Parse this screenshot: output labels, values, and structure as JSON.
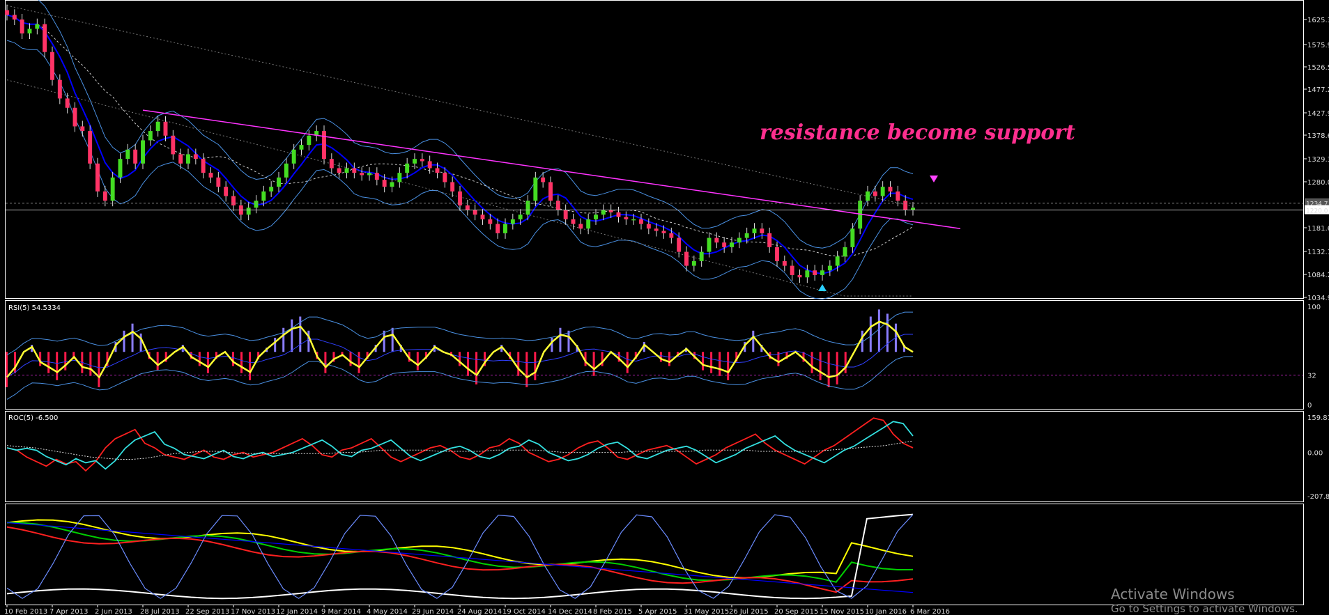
{
  "chart_data": [
    {
      "type": "candlestick",
      "panel": "price",
      "title": "",
      "y_ticks": [
        "1625.3",
        "1575.9",
        "1526.5",
        "1477.2",
        "1427.9",
        "1378.6",
        "1329.3",
        "1280.0",
        "1181.6",
        "1132.1",
        "1084.2",
        "1034.9"
      ],
      "ylim": [
        1034.9,
        1660
      ],
      "current_price_label": "1220.0",
      "upper_price_label": "1234.7",
      "x_labels": [
        "10 Feb 2013",
        "7 Apr 2013",
        "2 Jun 2013",
        "28 Jul 2013",
        "22 Sep 2013",
        "17 Nov 2013",
        "12 Jan 2014",
        "9 Mar 2014",
        "4 May 2014",
        "29 Jun 2014",
        "24 Aug 2014",
        "19 Oct 2014",
        "14 Dec 2014",
        "8 Feb 2015",
        "5 Apr 2015",
        "31 May 2015",
        "26 Jul 2015",
        "20 Sep 2015",
        "15 Nov 2015",
        "10 Jan 2016",
        "6 Mar 2016"
      ],
      "closes": [
        1640,
        1630,
        1600,
        1610,
        1620,
        1560,
        1500,
        1460,
        1440,
        1400,
        1390,
        1320,
        1260,
        1240,
        1290,
        1330,
        1350,
        1320,
        1370,
        1390,
        1410,
        1380,
        1340,
        1320,
        1340,
        1330,
        1300,
        1290,
        1270,
        1250,
        1230,
        1210,
        1225,
        1240,
        1260,
        1270,
        1290,
        1320,
        1350,
        1360,
        1380,
        1390,
        1330,
        1310,
        1300,
        1310,
        1300,
        1295,
        1300,
        1285,
        1270,
        1280,
        1300,
        1320,
        1330,
        1325,
        1310,
        1300,
        1280,
        1260,
        1230,
        1220,
        1210,
        1200,
        1190,
        1170,
        1190,
        1200,
        1210,
        1240,
        1290,
        1280,
        1240,
        1220,
        1200,
        1190,
        1180,
        1200,
        1210,
        1220,
        1215,
        1205,
        1200,
        1200,
        1190,
        1180,
        1175,
        1170,
        1160,
        1130,
        1100,
        1110,
        1130,
        1160,
        1150,
        1140,
        1150,
        1160,
        1170,
        1180,
        1170,
        1140,
        1110,
        1100,
        1080,
        1075,
        1090,
        1080,
        1090,
        1100,
        1120,
        1140,
        1180,
        1240,
        1260,
        1250,
        1270,
        1260,
        1240,
        1220,
        1225
      ],
      "annotations": [
        {
          "text": "resistance become support",
          "color": "#ff2f8f"
        }
      ],
      "trendline": {
        "from": [
          "28 Jul 2013",
          1435
        ],
        "to": [
          "6 Mar 2016",
          1195
        ],
        "color": "#ff33ff"
      },
      "arrows": [
        {
          "at": "15 Nov 2015",
          "dir": "up",
          "color": "#2ad0ff"
        },
        {
          "at": "6 Mar 2016",
          "dir": "down",
          "color": "#ff44ff"
        }
      ]
    },
    {
      "type": "bar+line",
      "panel": "rsi",
      "title": "RSI(5) 54.5334",
      "y_ticks": [
        "100",
        "32",
        "0"
      ],
      "ylim": [
        0,
        100
      ],
      "level": 32,
      "rsi_values": [
        30,
        40,
        55,
        60,
        45,
        40,
        35,
        42,
        50,
        40,
        38,
        30,
        45,
        62,
        70,
        75,
        68,
        50,
        42,
        48,
        55,
        60,
        50,
        45,
        40,
        50,
        55,
        45,
        40,
        35,
        50,
        58,
        65,
        72,
        78,
        80,
        70,
        50,
        40,
        48,
        52,
        45,
        40,
        50,
        60,
        70,
        72,
        60,
        48,
        42,
        50,
        60,
        55,
        52,
        45,
        38,
        32,
        45,
        55,
        60,
        50,
        38,
        30,
        35,
        55,
        65,
        72,
        70,
        60,
        45,
        38,
        45,
        55,
        48,
        40,
        50,
        62,
        55,
        48,
        45,
        52,
        58,
        50,
        42,
        40,
        38,
        35,
        48,
        62,
        70,
        60,
        50,
        45,
        50,
        55,
        48,
        40,
        35,
        30,
        32,
        40,
        55,
        70,
        80,
        85,
        82,
        75,
        60,
        55
      ]
    },
    {
      "type": "line",
      "panel": "roc",
      "title": "ROC(5) -6.500",
      "y_ticks": [
        "159.81",
        "0.00",
        "-207.81"
      ],
      "ylim": [
        -207.81,
        159.81
      ],
      "roc_values": [
        20,
        10,
        -20,
        -40,
        -60,
        -30,
        -50,
        -40,
        -80,
        -40,
        20,
        60,
        80,
        100,
        40,
        20,
        -10,
        -20,
        -30,
        -10,
        10,
        -20,
        -30,
        -10,
        0,
        -20,
        -10,
        0,
        20,
        40,
        60,
        30,
        -10,
        -20,
        10,
        20,
        40,
        60,
        20,
        -20,
        -40,
        -20,
        0,
        20,
        30,
        10,
        -20,
        -30,
        -10,
        20,
        30,
        60,
        40,
        0,
        -20,
        -40,
        -30,
        -10,
        20,
        40,
        50,
        20,
        -20,
        -30,
        -10,
        10,
        20,
        30,
        10,
        -20,
        -50,
        -30,
        -10,
        20,
        40,
        60,
        80,
        40,
        10,
        -10,
        -30,
        -50,
        -20,
        10,
        30,
        60,
        90,
        120,
        150,
        140,
        80,
        40,
        20
      ],
      "signal_values": [
        30,
        25,
        20,
        10,
        0,
        -10,
        -20,
        -25,
        -30,
        -30,
        -25,
        -15,
        -5,
        0,
        5,
        5,
        0,
        -5,
        -5,
        -5,
        -5,
        -5,
        -5,
        -5,
        0,
        0,
        5,
        10,
        10,
        10,
        10,
        5,
        5,
        5,
        5,
        10,
        10,
        10,
        10,
        5,
        0,
        0,
        0,
        0,
        0,
        5,
        5,
        5,
        5,
        5,
        10,
        10,
        10,
        10,
        5,
        5,
        5,
        5,
        5,
        10,
        15,
        20,
        25,
        30,
        40,
        50
      ]
    },
    {
      "type": "line",
      "panel": "oscillators",
      "title": "",
      "series_colors": [
        "#ffff00",
        "#00d000",
        "#ff2020",
        "#ffffff",
        "#6b8cff",
        "#0000ff"
      ]
    }
  ],
  "watermark": {
    "line1": "Activate Windows",
    "line2": "Go to Settings to activate Windows."
  },
  "colors": {
    "background": "#000000",
    "bull_candle": "#44dd22",
    "bear_candle": "#ff3366",
    "band": "#4a90e2",
    "ma": "#0000ff",
    "rsi_line": "#ffff33",
    "rsi_bar_up": "#8a7dff",
    "rsi_bar_down": "#ff1a4a",
    "roc_line": "#ff2020",
    "roc_alt": "#33e0e0",
    "grid_axis": "#ffffff"
  }
}
